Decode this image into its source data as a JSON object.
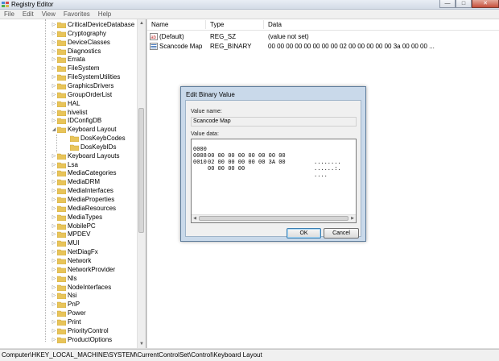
{
  "window": {
    "title": "Registry Editor",
    "minimize_glyph": "—",
    "maximize_glyph": "□",
    "close_glyph": "✕"
  },
  "menu": [
    "File",
    "Edit",
    "View",
    "Favorites",
    "Help"
  ],
  "tree": [
    {
      "label": "CriticalDeviceDatabase"
    },
    {
      "label": "Cryptography"
    },
    {
      "label": "DeviceClasses"
    },
    {
      "label": "Diagnostics"
    },
    {
      "label": "Errata"
    },
    {
      "label": "FileSystem"
    },
    {
      "label": "FileSystemUtilities"
    },
    {
      "label": "GraphicsDrivers"
    },
    {
      "label": "GroupOrderList"
    },
    {
      "label": "HAL"
    },
    {
      "label": "hivelist"
    },
    {
      "label": "IDConfigDB"
    },
    {
      "label": "Keyboard Layout",
      "expanded": true
    },
    {
      "label": "DosKeybCodes",
      "child": true
    },
    {
      "label": "DosKeybIDs",
      "child": true
    },
    {
      "label": "Keyboard Layouts"
    },
    {
      "label": "Lsa"
    },
    {
      "label": "MediaCategories"
    },
    {
      "label": "MediaDRM"
    },
    {
      "label": "MediaInterfaces"
    },
    {
      "label": "MediaProperties"
    },
    {
      "label": "MediaResources"
    },
    {
      "label": "MediaTypes"
    },
    {
      "label": "MobilePC"
    },
    {
      "label": "MPDEV"
    },
    {
      "label": "MUI"
    },
    {
      "label": "NetDiagFx"
    },
    {
      "label": "Network"
    },
    {
      "label": "NetworkProvider"
    },
    {
      "label": "Nls"
    },
    {
      "label": "NodeInterfaces"
    },
    {
      "label": "Nsi"
    },
    {
      "label": "PnP"
    },
    {
      "label": "Power"
    },
    {
      "label": "Print"
    },
    {
      "label": "PriorityControl"
    },
    {
      "label": "ProductOptions"
    }
  ],
  "columns": {
    "name": "Name",
    "type": "Type",
    "data": "Data"
  },
  "values": [
    {
      "name": "(Default)",
      "type": "REG_SZ",
      "data": "(value not set)",
      "icon": "string-value-icon"
    },
    {
      "name": "Scancode Map",
      "type": "REG_BINARY",
      "data": "00 00 00 00 00 00 00 00 02 00 00 00 00 00 3a 00 00 00 ...",
      "icon": "binary-value-icon"
    }
  ],
  "status": "Computer\\HKEY_LOCAL_MACHINE\\SYSTEM\\CurrentControlSet\\Control\\Keyboard Layout",
  "dialog": {
    "title": "Edit Binary Value",
    "value_name_label": "Value name:",
    "value_name": "Scancode Map",
    "value_data_label": "Value data:",
    "hex_rows": [
      {
        "offset": "0000",
        "bytes": "00 00 00 00 00 00 00 00",
        "ascii": "........"
      },
      {
        "offset": "0008",
        "bytes": "02 00 00 00 00 00 3A 00",
        "ascii": "......:."
      },
      {
        "offset": "0010",
        "bytes": "00 00 00 00",
        "ascii": "...."
      }
    ],
    "ok_label": "OK",
    "cancel_label": "Cancel"
  },
  "colors": {
    "folder": "#e8c45a",
    "folder_dark": "#c9a233",
    "dialog_frame": "#c9d9ea",
    "close_button": "#c6503c"
  }
}
